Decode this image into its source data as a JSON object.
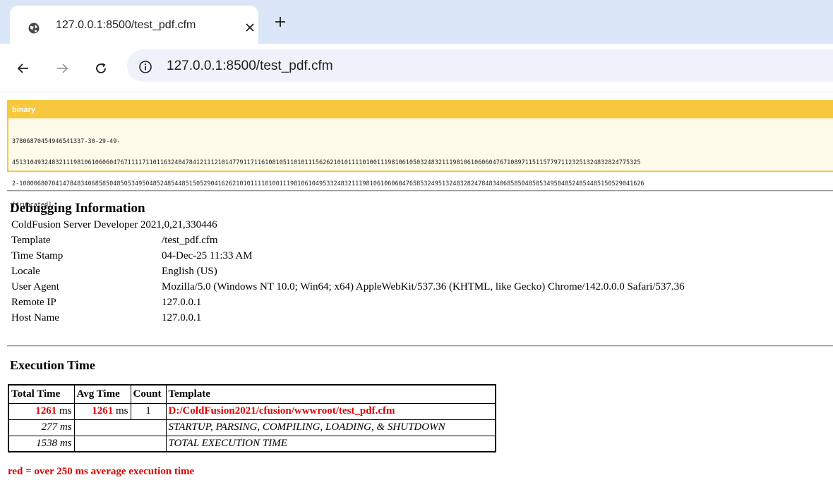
{
  "browser": {
    "tab_title": "127.0.0.1:8500/test_pdf.cfm",
    "url": "127.0.0.1:8500/test_pdf.cfm",
    "icons": [
      "globe-icon",
      "close-icon",
      "plus-icon",
      "back-arrow-icon",
      "forward-arrow-icon",
      "reload-icon",
      "info-icon"
    ]
  },
  "dump": {
    "label": "binary",
    "lines": [
      "37806870454946541337-30-29-49-",
      "451310493248321119810610606047671111711011632484784121112101477911711610810511010111562621010111101001119810610503248321119810610606047671089711511577971123251324832824775325",
      "2-10800680704147848340685850485053495048524854485150529041626210101111010011198106104953324832111981061060604765853249513248328247848340685850485053495048524854485150529041626",
      "[truncated]"
    ]
  },
  "debug": {
    "title": "Debugging Information",
    "server": "ColdFusion Server Developer 2021,0,21,330446",
    "rows": [
      {
        "label": "Template",
        "value": "/test_pdf.cfm"
      },
      {
        "label": "Time Stamp",
        "value": "04-Dec-25 11:33 AM"
      },
      {
        "label": "Locale",
        "value": "English (US)"
      },
      {
        "label": "User Agent",
        "value": "Mozilla/5.0 (Windows NT 10.0; Win64; x64) AppleWebKit/537.36 (KHTML, like Gecko) Chrome/142.0.0.0 Safari/537.36"
      },
      {
        "label": "Remote IP",
        "value": "127.0.0.1"
      },
      {
        "label": "Host Name",
        "value": "127.0.0.1"
      }
    ]
  },
  "execution": {
    "title": "Execution Time",
    "headers": [
      "Total Time",
      "Avg Time",
      "Count",
      "Template"
    ],
    "row1": {
      "total_num": "1261",
      "total_unit": "ms",
      "avg_num": "1261",
      "avg_unit": "ms",
      "count": "1",
      "template": "D:/ColdFusion2021/cfusion/wwwroot/test_pdf.cfm"
    },
    "row2": {
      "total": "277 ms",
      "template": "STARTUP, PARSING, COMPILING, LOADING, & SHUTDOWN"
    },
    "row3": {
      "total": "1538 ms",
      "template": "TOTAL EXECUTION TIME"
    },
    "legend": "red = over 250 ms average execution time",
    "colors": {
      "highlight": "#e00000"
    }
  }
}
